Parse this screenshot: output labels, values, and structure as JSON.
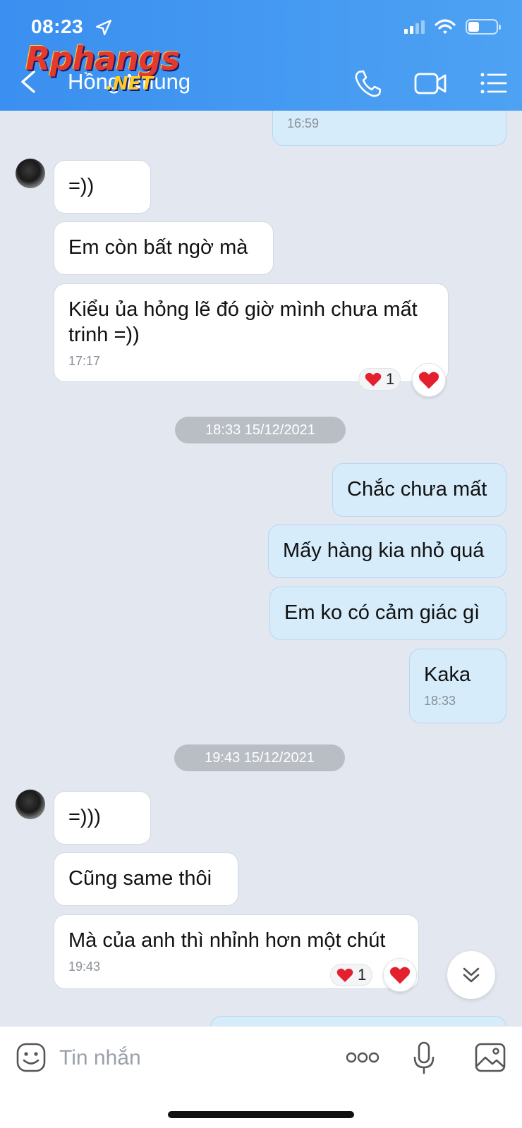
{
  "status_bar": {
    "time": "08:23"
  },
  "header": {
    "contact_name": "Hồng Nhung",
    "watermark": "Rphangs",
    "watermark_sub": ".NET"
  },
  "messages": {
    "top_partial": {
      "time": "16:59"
    },
    "m1": {
      "text": "=))"
    },
    "m2": {
      "text": "Em còn bất ngờ mà"
    },
    "m3": {
      "line1": "Kiểu ủa hỏng lẽ đó giờ mình chưa mất",
      "line2": "trinh =))",
      "time": "17:17",
      "reaction_count": "1"
    },
    "date1": "18:33 15/12/2021",
    "m4": {
      "text": "Chắc chưa mất"
    },
    "m5": {
      "text": "Mấy hàng kia nhỏ quá"
    },
    "m6": {
      "text": "Em ko có cảm giác gì"
    },
    "m7": {
      "text": "Kaka",
      "time": "18:33"
    },
    "date2": "19:43 15/12/2021",
    "m8": {
      "text": "=)))"
    },
    "m9": {
      "text": "Cũng same thôi"
    },
    "m10": {
      "text": "Mà của anh thì nhỉnh hơn một chút",
      "time": "19:43",
      "reaction_count": "1"
    }
  },
  "input": {
    "placeholder": "Tin nhắn"
  },
  "colors": {
    "header": "#4a9cf2",
    "outgoing_bubble": "#d6ecfb",
    "incoming_bubble": "#ffffff",
    "background": "#e3e7ef",
    "heart": "#e5202e"
  },
  "icons": [
    "location-arrow-icon",
    "signal-icon",
    "wifi-icon",
    "battery-icon",
    "back-arrow-icon",
    "phone-icon",
    "video-call-icon",
    "list-menu-icon",
    "heart-icon",
    "chevron-double-down-icon",
    "sticker-icon",
    "more-dots-icon",
    "microphone-icon",
    "image-icon"
  ]
}
